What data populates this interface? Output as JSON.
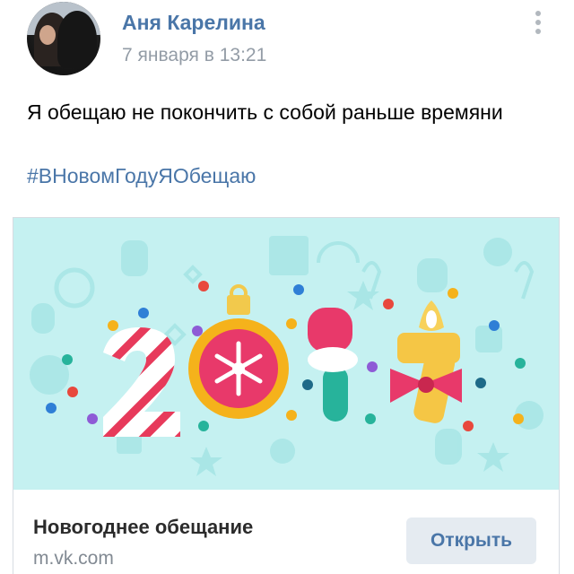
{
  "post": {
    "author": "Аня Карелина",
    "date": "7 января в 13:21",
    "text": "Я обещаю не покончить с собой раньше времяни",
    "hashtag": "#ВНовомГодуЯОбещаю"
  },
  "link_card": {
    "banner_text": "2017",
    "title": "Новогоднее обещание",
    "domain": "m.vk.com",
    "button_label": "Открыть"
  },
  "icons": {
    "more": "more-vertical-icon"
  },
  "colors": {
    "accent": "#4a76a8",
    "muted": "#939ca6",
    "banner_bg": "#c5f1f1",
    "button_bg": "#e5ebf1"
  }
}
